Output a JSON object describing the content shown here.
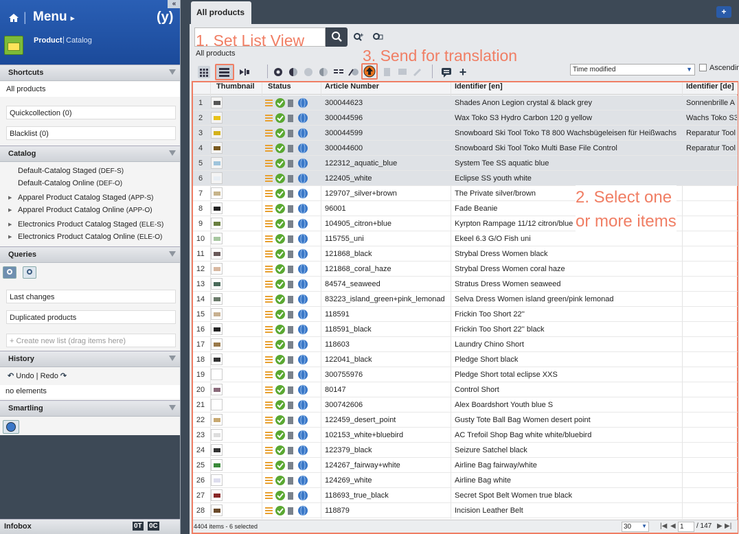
{
  "nav": {
    "menu": "Menu",
    "logo": "(y)",
    "product": "Product",
    "catalog": "Catalog",
    "collapse": "«"
  },
  "shortcuts": {
    "title": "Shortcuts",
    "all_products": "All products",
    "quickcollection": "Quickcollection (0)",
    "blacklist": "Blacklist (0)"
  },
  "catalog": {
    "title": "Catalog",
    "items": [
      {
        "name": "Default-Catalog Staged",
        "code": "(DEF-S)"
      },
      {
        "name": "Default-Catalog Online",
        "code": "(DEF-O)"
      },
      {
        "name": "Apparel Product Catalog Staged",
        "code": "(APP-S)"
      },
      {
        "name": "Apparel Product Catalog Online",
        "code": "(APP-O)"
      },
      {
        "name": "Electronics Product Catalog Staged",
        "code": "(ELE-S)"
      },
      {
        "name": "Electronics Product Catalog Online",
        "code": "(ELE-O)"
      }
    ]
  },
  "queries": {
    "title": "Queries",
    "last_changes": "Last changes",
    "duplicated": "Duplicated products",
    "create": "+ Create new list (drag items here)"
  },
  "history": {
    "title": "History",
    "undo": "Undo",
    "redo": "Redo",
    "empty": "no elements"
  },
  "smartling": {
    "title": "Smartling"
  },
  "infobox": {
    "title": "Infobox",
    "badge1": "0T",
    "badge2": "0C"
  },
  "tab": {
    "label": "All products",
    "plus": "+"
  },
  "search": {
    "value": "",
    "breadcrumb": "All products"
  },
  "annotations": {
    "a1": "1. Set List View",
    "a2": "2. Select one\nor more items",
    "a2a": "2. Select one",
    "a2b": "or more items",
    "a3": "3. Send for translation"
  },
  "sort": {
    "value": "Time modified",
    "ascending": "Ascendin"
  },
  "columns": {
    "thumbnail": "Thumbnail",
    "status": "Status",
    "article": "Article Number",
    "id_en": "Identifier [en]",
    "id_de": "Identifier [de]"
  },
  "rows": [
    {
      "n": "1",
      "art": "300044623",
      "en": "Shades Anon Legion crystal & black grey",
      "de": "Sonnenbrille A",
      "sel": true
    },
    {
      "n": "2",
      "art": "300044596",
      "en": "Wax Toko S3 Hydro Carbon 120 g yellow",
      "de": "Wachs Toko S3",
      "sel": true
    },
    {
      "n": "3",
      "art": "300044599",
      "en": "Snowboard Ski Tool Toko T8 800 Wachsbügeleisen für Heißwachs",
      "de": "Reparatur Tool",
      "sel": true
    },
    {
      "n": "4",
      "art": "300044600",
      "en": "Snowboard Ski Tool Toko Multi Base File Control",
      "de": "Reparatur Tool",
      "sel": true
    },
    {
      "n": "5",
      "art": "122312_aquatic_blue",
      "en": "System Tee SS aquatic blue",
      "de": "",
      "sel": true
    },
    {
      "n": "6",
      "art": "122405_white",
      "en": "Eclipse SS youth white",
      "de": "",
      "sel": true
    },
    {
      "n": "7",
      "art": "129707_silver+brown",
      "en": "The Private silver/brown",
      "de": "",
      "sel": false
    },
    {
      "n": "8",
      "art": "96001",
      "en": "Fade Beanie",
      "de": "",
      "sel": false
    },
    {
      "n": "9",
      "art": "104905_citron+blue",
      "en": "Kyrpton Rampage 11/12 citron/blue",
      "de": "",
      "sel": false
    },
    {
      "n": "10",
      "art": "115755_uni",
      "en": "Ekeel 6.3 G/O Fish uni",
      "de": "",
      "sel": false
    },
    {
      "n": "11",
      "art": "121868_black",
      "en": "Strybal Dress Women black",
      "de": "",
      "sel": false
    },
    {
      "n": "12",
      "art": "121868_coral_haze",
      "en": "Strybal Dress Women coral haze",
      "de": "",
      "sel": false
    },
    {
      "n": "13",
      "art": "84574_seaweed",
      "en": "Stratus Dress Women seaweed",
      "de": "",
      "sel": false
    },
    {
      "n": "14",
      "art": "83223_island_green+pink_lemonad",
      "en": "Selva Dress Women island green/pink lemonad",
      "de": "",
      "sel": false
    },
    {
      "n": "15",
      "art": "118591",
      "en": "Frickin Too Short 22''",
      "de": "",
      "sel": false
    },
    {
      "n": "16",
      "art": "118591_black",
      "en": "Frickin Too Short 22'' black",
      "de": "",
      "sel": false
    },
    {
      "n": "17",
      "art": "118603",
      "en": "Laundry Chino Short",
      "de": "",
      "sel": false
    },
    {
      "n": "18",
      "art": "122041_black",
      "en": "Pledge Short black",
      "de": "",
      "sel": false
    },
    {
      "n": "19",
      "art": "300755976",
      "en": "Pledge Short total eclipse XXS",
      "de": "",
      "sel": false
    },
    {
      "n": "20",
      "art": "80147",
      "en": "Control Short",
      "de": "",
      "sel": false
    },
    {
      "n": "21",
      "art": "300742606",
      "en": "Alex Boardshort Youth blue S",
      "de": "",
      "sel": false
    },
    {
      "n": "22",
      "art": "122459_desert_point",
      "en": "Gusty Tote Ball Bag Women desert point",
      "de": "",
      "sel": false
    },
    {
      "n": "23",
      "art": "102153_white+bluebird",
      "en": "AC Trefoil Shop Bag white white/bluebird",
      "de": "",
      "sel": false
    },
    {
      "n": "24",
      "art": "122379_black",
      "en": "Seizure Satchel black",
      "de": "",
      "sel": false
    },
    {
      "n": "25",
      "art": "124267_fairway+white",
      "en": "Airline Bag fairway/white",
      "de": "",
      "sel": false
    },
    {
      "n": "26",
      "art": "124269_white",
      "en": "Airline Bag white",
      "de": "",
      "sel": false
    },
    {
      "n": "27",
      "art": "118693_true_black",
      "en": "Secret Spot Belt Women true black",
      "de": "",
      "sel": false
    },
    {
      "n": "28",
      "art": "118879",
      "en": "Incision Leather Belt",
      "de": "",
      "sel": false
    }
  ],
  "footer": {
    "count": "4404 items - 6 selected",
    "page_size": "30",
    "page": "1",
    "total": "/ 147"
  },
  "colors": {
    "accent": "#f07e64",
    "brand": "#2a5fb5",
    "check": "#5aa832",
    "globe": "#3a78c8"
  }
}
